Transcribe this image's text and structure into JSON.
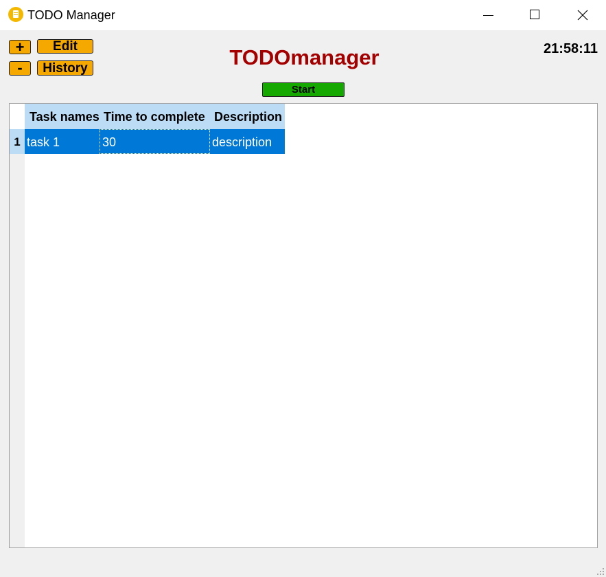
{
  "window": {
    "title": "TODO Manager"
  },
  "toolbar": {
    "add_label": "+",
    "remove_label": "-",
    "edit_label": "Edit",
    "history_label": "History",
    "start_label": "Start"
  },
  "header": {
    "app_title": "TODOmanager",
    "clock": "21:58:11"
  },
  "table": {
    "columns": [
      "Task names",
      "Time to complete",
      "Description"
    ],
    "rows": [
      {
        "index": "1",
        "cells": [
          "task 1",
          "30",
          "description"
        ]
      }
    ]
  },
  "colors": {
    "accent_button": "#f5a800",
    "start_button": "#14a800",
    "title_color": "#a40000",
    "selection": "#0078d7",
    "header_bg": "#bcdcf5"
  },
  "icons": {
    "app": "notepad-icon",
    "minimize": "minimize-icon",
    "maximize": "maximize-icon",
    "close": "close-icon",
    "grip": "resize-grip-icon"
  }
}
